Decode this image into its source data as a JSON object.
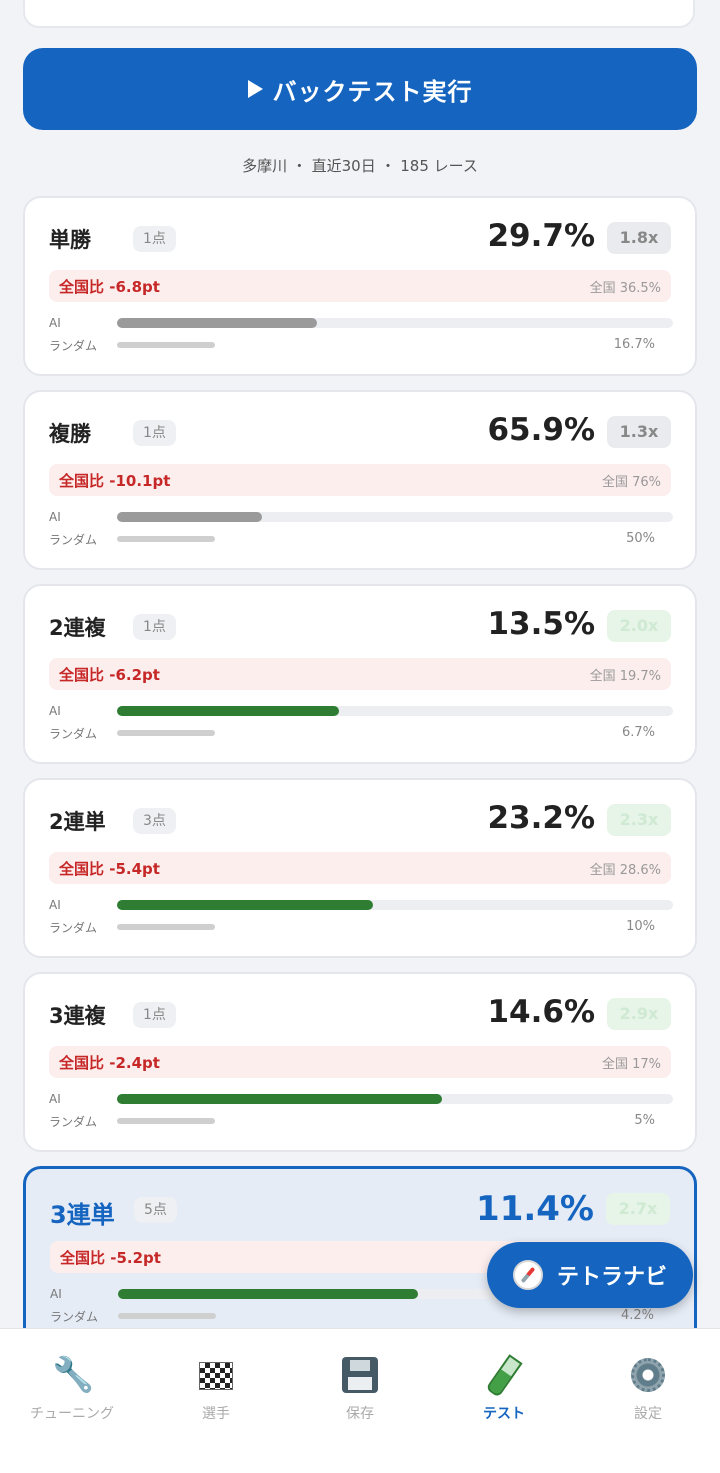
{
  "run_button": {
    "label": "バックテスト実行"
  },
  "summary": "多摩川 ・ 直近30日 ・ 185 レース",
  "labels": {
    "ai": "AI",
    "random": "ランダム"
  },
  "cards": [
    {
      "name": "単勝",
      "points": "1点",
      "rate": "29.7%",
      "mult": "1.8x",
      "mult_style": "gray",
      "diff": "全国比 -6.8pt",
      "national": "全国 36.5%",
      "ai_fraction": 0.36,
      "ai_style": "gray",
      "random": "16.7%"
    },
    {
      "name": "複勝",
      "points": "1点",
      "rate": "65.9%",
      "mult": "1.3x",
      "mult_style": "gray",
      "diff": "全国比 -10.1pt",
      "national": "全国 76%",
      "ai_fraction": 0.26,
      "ai_style": "gray",
      "random": "50%"
    },
    {
      "name": "2連複",
      "points": "1点",
      "rate": "13.5%",
      "mult": "2.0x",
      "mult_style": "green",
      "diff": "全国比 -6.2pt",
      "national": "全国 19.7%",
      "ai_fraction": 0.4,
      "ai_style": "green",
      "random": "6.7%"
    },
    {
      "name": "2連単",
      "points": "3点",
      "rate": "23.2%",
      "mult": "2.3x",
      "mult_style": "green",
      "diff": "全国比 -5.4pt",
      "national": "全国 28.6%",
      "ai_fraction": 0.46,
      "ai_style": "green",
      "random": "10%"
    },
    {
      "name": "3連複",
      "points": "1点",
      "rate": "14.6%",
      "mult": "2.9x",
      "mult_style": "green",
      "diff": "全国比 -2.4pt",
      "national": "全国 17%",
      "ai_fraction": 0.585,
      "ai_style": "green",
      "random": "5%"
    },
    {
      "name": "3連単",
      "points": "5点",
      "rate": "11.4%",
      "mult": "2.7x",
      "mult_style": "green",
      "diff": "全国比 -5.2pt",
      "national": "",
      "ai_fraction": 0.54,
      "ai_style": "green",
      "random": "4.2%",
      "selected": true
    }
  ],
  "fab": {
    "label": "テトラナビ",
    "icon": "compass-icon"
  },
  "tabs": [
    {
      "label": "チューニング",
      "icon": "wrench-icon",
      "active": false
    },
    {
      "label": "選手",
      "icon": "checkered-flag-icon",
      "active": false
    },
    {
      "label": "保存",
      "icon": "floppy-disk-icon",
      "active": false
    },
    {
      "label": "テスト",
      "icon": "test-tube-icon",
      "active": true
    },
    {
      "label": "設定",
      "icon": "gear-icon",
      "active": false
    }
  ],
  "colors": {
    "accent": "#1565c0",
    "negative": "#c62828",
    "ai_good": "#2e7d32"
  }
}
